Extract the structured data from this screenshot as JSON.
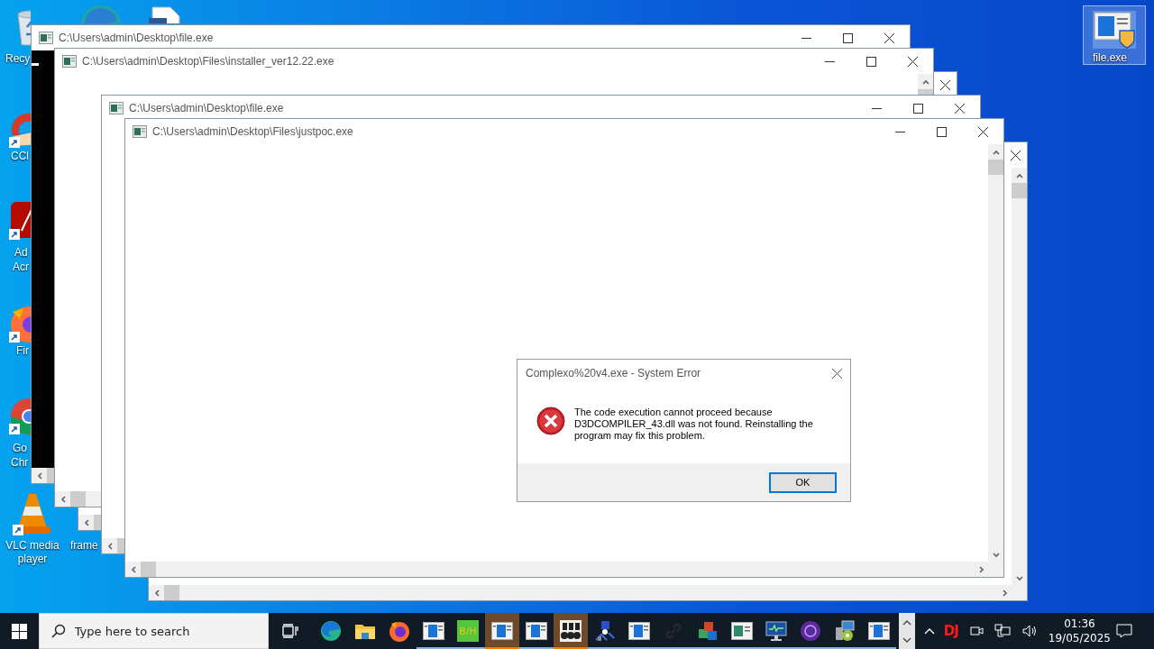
{
  "desktop_icons": [
    {
      "kind": "recycle-bin",
      "selected": false,
      "lines": [
        "Recy"
      ]
    },
    {
      "kind": "edge",
      "selected": false
    },
    {
      "kind": "document",
      "selected": false
    },
    {
      "kind": "ccleaner",
      "shortcut": true,
      "selected": false,
      "lines": [
        "CCl"
      ]
    },
    {
      "kind": "acrobat",
      "shortcut": true,
      "selected": false,
      "lines": [
        "Ad",
        "Acr"
      ]
    },
    {
      "kind": "firefox",
      "shortcut": true,
      "selected": false,
      "lines": [
        "Fir"
      ]
    },
    {
      "kind": "chrome",
      "shortcut": true,
      "selected": false,
      "lines": [
        "Go",
        "Chr"
      ]
    },
    {
      "kind": "vlc",
      "shortcut": true,
      "selected": false,
      "lines": [
        "VLC media player"
      ]
    },
    {
      "kind": "label-only",
      "selected": false,
      "lines": [
        "frame"
      ]
    },
    {
      "kind": "setup-file",
      "selected": true,
      "lines": [
        "file.exe"
      ]
    }
  ],
  "windows": [
    {
      "title": "C:\\Users\\admin\\Desktop\\file.exe",
      "kind": "console"
    },
    {
      "title": "C:\\Users\\admin\\Desktop\\Files\\installer_ver12.22.exe",
      "kind": "blank"
    },
    {
      "kind": "blank"
    },
    {
      "title": "C:\\Users\\admin\\Desktop\\file.exe",
      "kind": "blank"
    },
    {
      "title": "C:\\Users\\admin\\Desktop\\Files\\justpoc.exe",
      "kind": "blank"
    },
    {
      "kind": "blank"
    }
  ],
  "dialog": {
    "title": "Complexo%20v4.exe - System Error",
    "message": "The code execution cannot proceed because D3DCOMPILER_43.dll was not found. Reinstalling the program may fix this problem.",
    "buttons": [
      "OK"
    ]
  },
  "taskbar": {
    "search": {
      "placeholder": "Type here to search"
    },
    "items": [
      {
        "kind": "task-view",
        "running": false,
        "active": false
      },
      {
        "kind": "edge",
        "running": false,
        "active": false
      },
      {
        "kind": "explorer",
        "running": false,
        "active": false
      },
      {
        "kind": "firefox",
        "running": false,
        "active": false
      },
      {
        "kind": "app-window",
        "running": true,
        "active": false
      },
      {
        "kind": "text-tile",
        "label": "B/H",
        "running": true,
        "active": false
      },
      {
        "kind": "app-window",
        "running": true,
        "active": true
      },
      {
        "kind": "app-window",
        "running": true,
        "active": false
      },
      {
        "kind": "binoculars",
        "running": true,
        "active": true
      },
      {
        "kind": "network-tool",
        "running": true,
        "active": false
      },
      {
        "kind": "app-window",
        "running": true,
        "active": false
      },
      {
        "kind": "link",
        "running": true,
        "active": false
      },
      {
        "kind": "office",
        "running": true,
        "active": false
      },
      {
        "kind": "green-window",
        "running": true,
        "active": false
      },
      {
        "kind": "monitor",
        "running": true,
        "active": false
      },
      {
        "kind": "purple-disc",
        "running": true,
        "active": false
      },
      {
        "kind": "installer",
        "running": true,
        "active": false
      },
      {
        "kind": "app-window",
        "running": true,
        "active": false
      }
    ],
    "tray": {
      "badge": "DJ",
      "time": "01:36",
      "date": "19/05/2025"
    }
  }
}
